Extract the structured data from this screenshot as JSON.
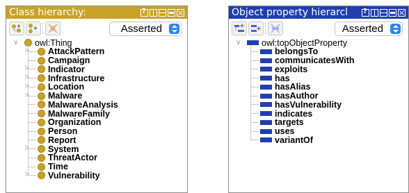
{
  "colors": {
    "class_title_bg": "#c9a227",
    "property_title_bg": "#1f3fb0",
    "class_dot": "#c9a227",
    "property_bar": "#1f3fb0",
    "select_arrow": "#2f84f0"
  },
  "class_panel": {
    "title": "Class hierarchy:",
    "window_buttons": [
      "help-icon",
      "columns-icon",
      "rows-icon",
      "minimize-icon",
      "close-icon"
    ],
    "toolbar_icons": [
      "add-subclass-icon",
      "add-sibling-class-icon",
      "delete-class-icon"
    ],
    "mode_select": "Asserted",
    "root": "owl:Thing",
    "items": [
      {
        "label": "AttackPattern",
        "expandable": true
      },
      {
        "label": "Campaign",
        "expandable": false
      },
      {
        "label": "Indicator",
        "expandable": true
      },
      {
        "label": "Infrastructure",
        "expandable": true
      },
      {
        "label": "Location",
        "expandable": true
      },
      {
        "label": "Malware",
        "expandable": true
      },
      {
        "label": "MalwareAnalysis",
        "expandable": false
      },
      {
        "label": "MalwareFamily",
        "expandable": false
      },
      {
        "label": "Organization",
        "expandable": false
      },
      {
        "label": "Person",
        "expandable": false
      },
      {
        "label": "Report",
        "expandable": false
      },
      {
        "label": "System",
        "expandable": true
      },
      {
        "label": "ThreatActor",
        "expandable": false
      },
      {
        "label": "Time",
        "expandable": false
      },
      {
        "label": "Vulnerability",
        "expandable": true
      }
    ]
  },
  "property_panel": {
    "title": "Object property hierarcl",
    "window_buttons": [
      "help-icon",
      "columns-icon",
      "rows-icon",
      "minimize-icon",
      "close-icon"
    ],
    "toolbar_icons": [
      "add-subproperty-icon",
      "add-sibling-property-icon",
      "delete-property-icon"
    ],
    "mode_select": "Asserted",
    "root": "owl:topObjectProperty",
    "items": [
      {
        "label": "belongsTo"
      },
      {
        "label": "communicatesWith"
      },
      {
        "label": "exploits"
      },
      {
        "label": "has"
      },
      {
        "label": "hasAlias"
      },
      {
        "label": "hasAuthor"
      },
      {
        "label": "hasVulnerability"
      },
      {
        "label": "indicates"
      },
      {
        "label": "targets"
      },
      {
        "label": "uses"
      },
      {
        "label": "variantOf"
      }
    ]
  }
}
